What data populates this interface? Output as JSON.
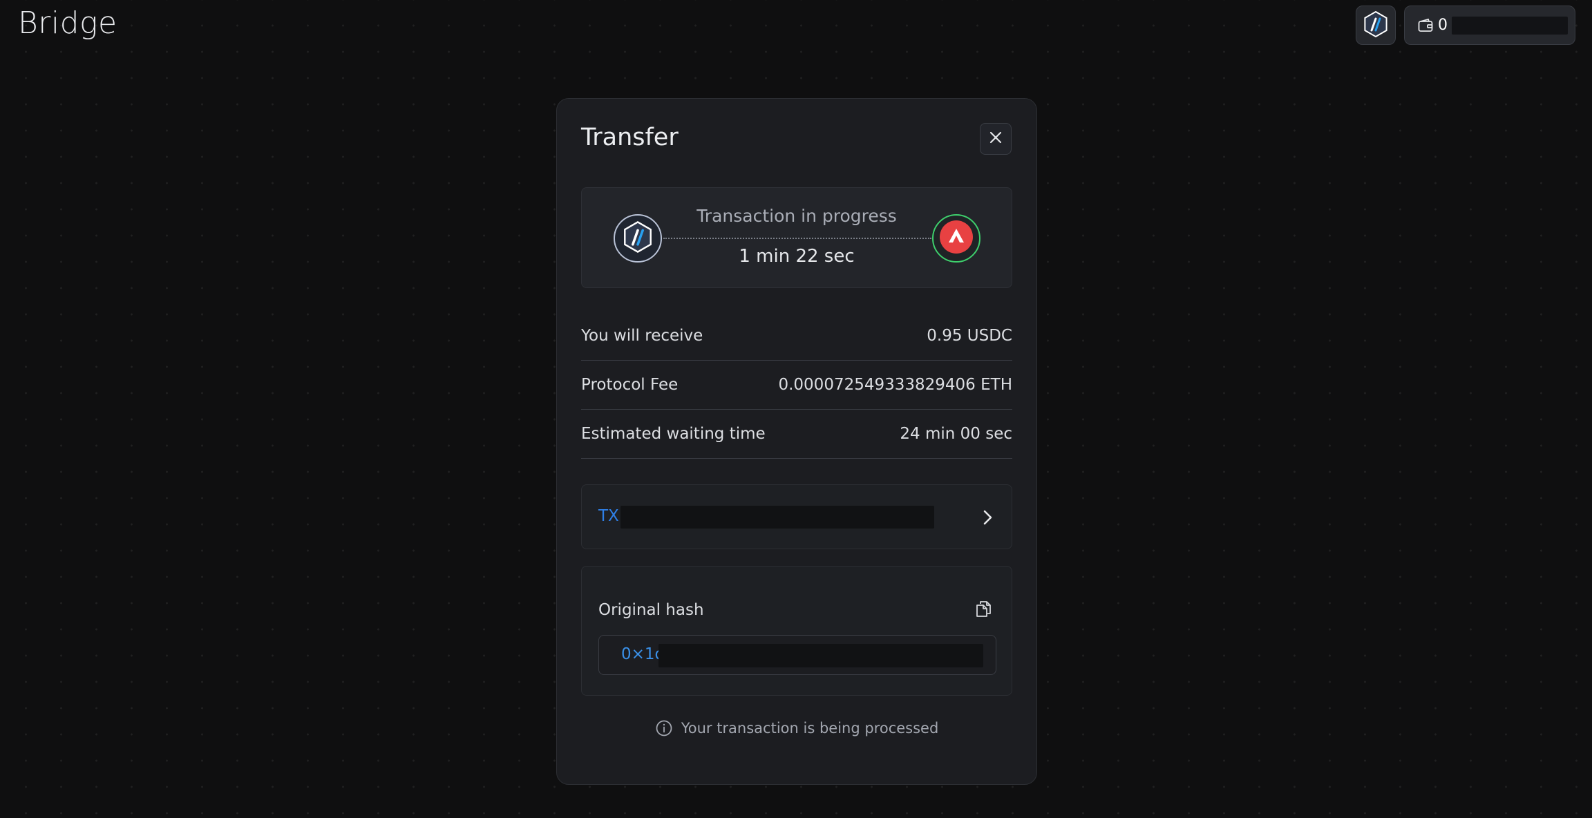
{
  "header": {
    "app_title": "Bridge",
    "wallet_balance": "0"
  },
  "icons": {
    "chain": "arbitrum-logo-icon",
    "wallet": "wallet-icon",
    "close": "close-icon",
    "destination_chain": "avalanche-logo-icon",
    "chevron": "chevron-right-icon",
    "copy": "copy-icon",
    "info": "info-icon"
  },
  "colors": {
    "accent_blue": "#2f7fe6",
    "success_green": "#3ecf6c",
    "avalanche_red": "#e84142",
    "background": "#0f0f10",
    "modal_background": "#1c1d21"
  },
  "modal": {
    "title": "Transfer",
    "progress": {
      "status": "Transaction in progress",
      "elapsed": "1 min 22 sec"
    },
    "details": [
      {
        "label": "You will receive",
        "value": "0.95 USDC"
      },
      {
        "label": "Protocol Fee",
        "value": "0.000072549333829406 ETH"
      },
      {
        "label": "Estimated waiting time",
        "value": "24 min 00 sec"
      }
    ],
    "tx": {
      "label": "TX"
    },
    "original_hash": {
      "label": "Original hash",
      "value_prefix": "0×1d"
    },
    "status_note": "Your transaction is being processed"
  }
}
